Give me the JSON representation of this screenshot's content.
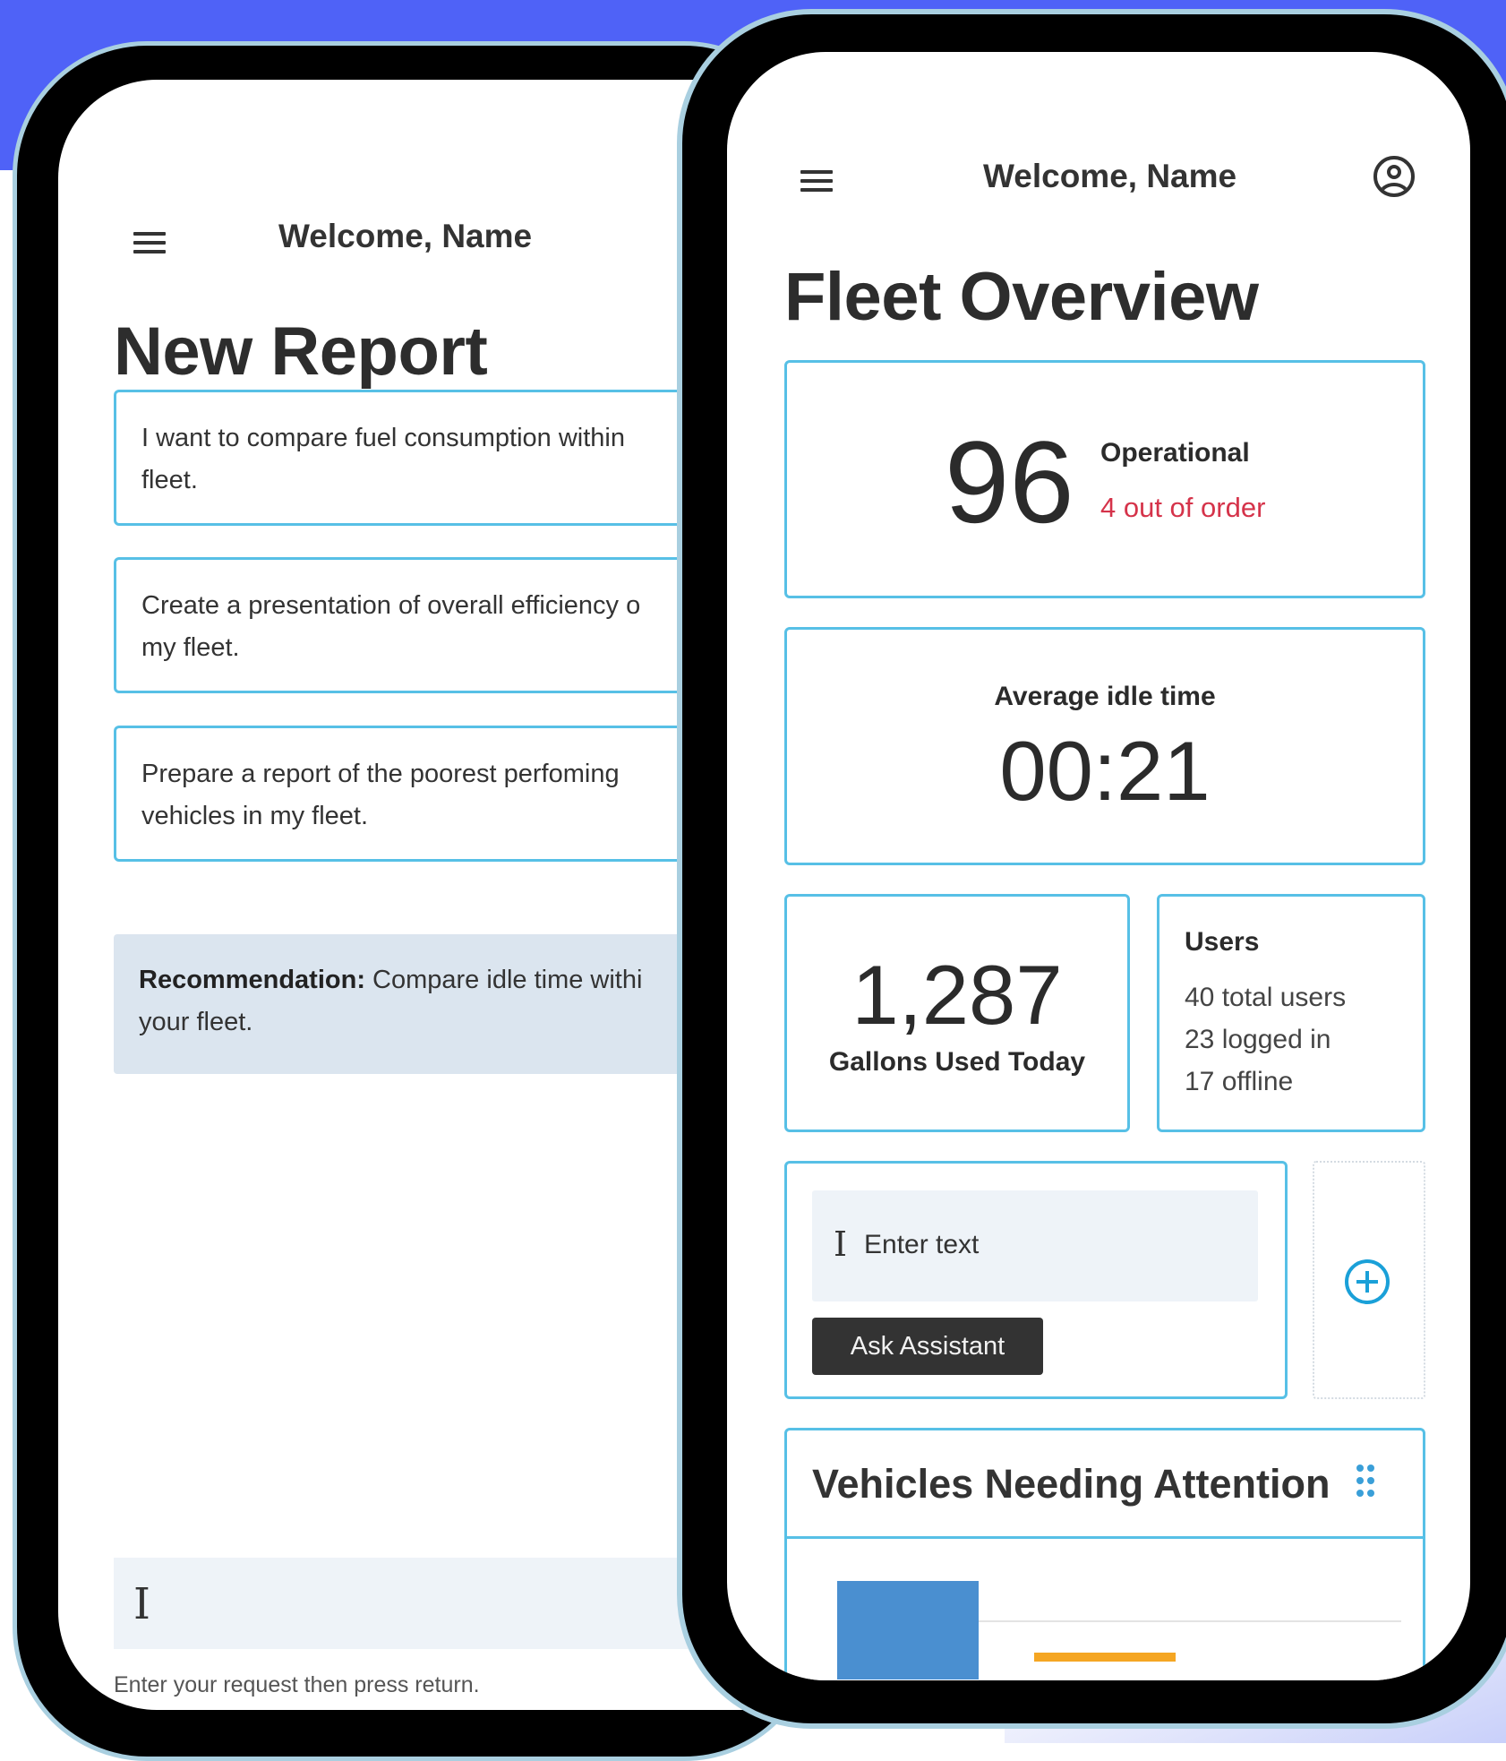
{
  "left_screen": {
    "welcome": "Welcome, Name",
    "title": "New Report",
    "prompts": [
      {
        "line1": "I want to compare fuel consumption within",
        "line2": "fleet."
      },
      {
        "line1": "Create a presentation of overall efficiency o",
        "line2": "my fleet."
      },
      {
        "line1": "Prepare a report of the poorest perfoming",
        "line2": "vehicles in my fleet."
      }
    ],
    "recommendation": {
      "label": "Recommendation:",
      "line1": " Compare idle time withi",
      "line2": "your fleet."
    },
    "request_hint": "Enter your request then press return."
  },
  "right_screen": {
    "welcome": "Welcome, Name",
    "title": "Fleet Overview",
    "operational": {
      "value": "96",
      "label": "Operational",
      "sub": "4 out of order"
    },
    "idle": {
      "label": "Average idle time",
      "value": "00:21"
    },
    "gallons": {
      "value": "1,287",
      "label": "Gallons Used Today"
    },
    "users": {
      "title": "Users",
      "total": "40 total users",
      "logged": "23 logged in",
      "offline": "17 offline"
    },
    "assistant": {
      "placeholder": "Enter text",
      "button": "Ask Assistant"
    },
    "vehicles": {
      "title": "Vehicles Needing Attention"
    }
  },
  "colors": {
    "accent": "#57c0e6",
    "alert": "#d5334a",
    "bar_blue": "#4a8fd0",
    "bar_orange": "#f5a623",
    "brand_band": "#4f62f7"
  },
  "icons": [
    "menu-icon",
    "account-circle-icon",
    "add-circle-icon",
    "drag-handle-icon",
    "text-cursor-icon"
  ]
}
